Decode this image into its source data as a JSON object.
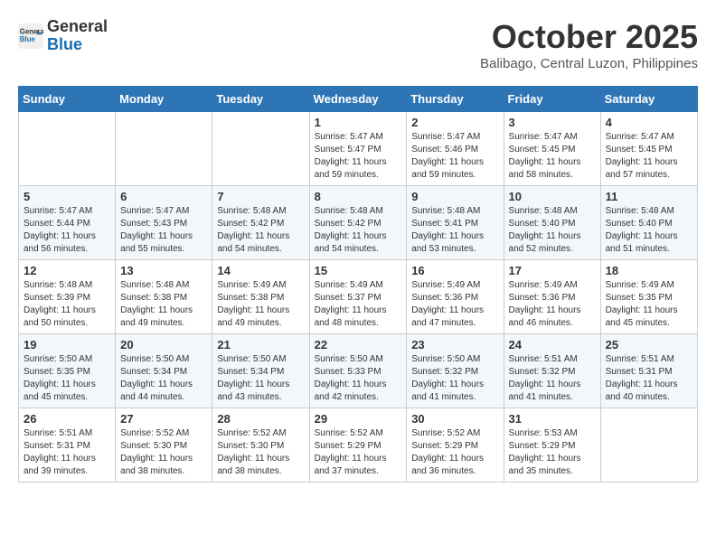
{
  "header": {
    "logo_line1": "General",
    "logo_line2": "Blue",
    "month": "October 2025",
    "location": "Balibago, Central Luzon, Philippines"
  },
  "weekdays": [
    "Sunday",
    "Monday",
    "Tuesday",
    "Wednesday",
    "Thursday",
    "Friday",
    "Saturday"
  ],
  "weeks": [
    [
      {
        "day": "",
        "info": ""
      },
      {
        "day": "",
        "info": ""
      },
      {
        "day": "",
        "info": ""
      },
      {
        "day": "1",
        "info": "Sunrise: 5:47 AM\nSunset: 5:47 PM\nDaylight: 11 hours\nand 59 minutes."
      },
      {
        "day": "2",
        "info": "Sunrise: 5:47 AM\nSunset: 5:46 PM\nDaylight: 11 hours\nand 59 minutes."
      },
      {
        "day": "3",
        "info": "Sunrise: 5:47 AM\nSunset: 5:45 PM\nDaylight: 11 hours\nand 58 minutes."
      },
      {
        "day": "4",
        "info": "Sunrise: 5:47 AM\nSunset: 5:45 PM\nDaylight: 11 hours\nand 57 minutes."
      }
    ],
    [
      {
        "day": "5",
        "info": "Sunrise: 5:47 AM\nSunset: 5:44 PM\nDaylight: 11 hours\nand 56 minutes."
      },
      {
        "day": "6",
        "info": "Sunrise: 5:47 AM\nSunset: 5:43 PM\nDaylight: 11 hours\nand 55 minutes."
      },
      {
        "day": "7",
        "info": "Sunrise: 5:48 AM\nSunset: 5:42 PM\nDaylight: 11 hours\nand 54 minutes."
      },
      {
        "day": "8",
        "info": "Sunrise: 5:48 AM\nSunset: 5:42 PM\nDaylight: 11 hours\nand 54 minutes."
      },
      {
        "day": "9",
        "info": "Sunrise: 5:48 AM\nSunset: 5:41 PM\nDaylight: 11 hours\nand 53 minutes."
      },
      {
        "day": "10",
        "info": "Sunrise: 5:48 AM\nSunset: 5:40 PM\nDaylight: 11 hours\nand 52 minutes."
      },
      {
        "day": "11",
        "info": "Sunrise: 5:48 AM\nSunset: 5:40 PM\nDaylight: 11 hours\nand 51 minutes."
      }
    ],
    [
      {
        "day": "12",
        "info": "Sunrise: 5:48 AM\nSunset: 5:39 PM\nDaylight: 11 hours\nand 50 minutes."
      },
      {
        "day": "13",
        "info": "Sunrise: 5:48 AM\nSunset: 5:38 PM\nDaylight: 11 hours\nand 49 minutes."
      },
      {
        "day": "14",
        "info": "Sunrise: 5:49 AM\nSunset: 5:38 PM\nDaylight: 11 hours\nand 49 minutes."
      },
      {
        "day": "15",
        "info": "Sunrise: 5:49 AM\nSunset: 5:37 PM\nDaylight: 11 hours\nand 48 minutes."
      },
      {
        "day": "16",
        "info": "Sunrise: 5:49 AM\nSunset: 5:36 PM\nDaylight: 11 hours\nand 47 minutes."
      },
      {
        "day": "17",
        "info": "Sunrise: 5:49 AM\nSunset: 5:36 PM\nDaylight: 11 hours\nand 46 minutes."
      },
      {
        "day": "18",
        "info": "Sunrise: 5:49 AM\nSunset: 5:35 PM\nDaylight: 11 hours\nand 45 minutes."
      }
    ],
    [
      {
        "day": "19",
        "info": "Sunrise: 5:50 AM\nSunset: 5:35 PM\nDaylight: 11 hours\nand 45 minutes."
      },
      {
        "day": "20",
        "info": "Sunrise: 5:50 AM\nSunset: 5:34 PM\nDaylight: 11 hours\nand 44 minutes."
      },
      {
        "day": "21",
        "info": "Sunrise: 5:50 AM\nSunset: 5:34 PM\nDaylight: 11 hours\nand 43 minutes."
      },
      {
        "day": "22",
        "info": "Sunrise: 5:50 AM\nSunset: 5:33 PM\nDaylight: 11 hours\nand 42 minutes."
      },
      {
        "day": "23",
        "info": "Sunrise: 5:50 AM\nSunset: 5:32 PM\nDaylight: 11 hours\nand 41 minutes."
      },
      {
        "day": "24",
        "info": "Sunrise: 5:51 AM\nSunset: 5:32 PM\nDaylight: 11 hours\nand 41 minutes."
      },
      {
        "day": "25",
        "info": "Sunrise: 5:51 AM\nSunset: 5:31 PM\nDaylight: 11 hours\nand 40 minutes."
      }
    ],
    [
      {
        "day": "26",
        "info": "Sunrise: 5:51 AM\nSunset: 5:31 PM\nDaylight: 11 hours\nand 39 minutes."
      },
      {
        "day": "27",
        "info": "Sunrise: 5:52 AM\nSunset: 5:30 PM\nDaylight: 11 hours\nand 38 minutes."
      },
      {
        "day": "28",
        "info": "Sunrise: 5:52 AM\nSunset: 5:30 PM\nDaylight: 11 hours\nand 38 minutes."
      },
      {
        "day": "29",
        "info": "Sunrise: 5:52 AM\nSunset: 5:29 PM\nDaylight: 11 hours\nand 37 minutes."
      },
      {
        "day": "30",
        "info": "Sunrise: 5:52 AM\nSunset: 5:29 PM\nDaylight: 11 hours\nand 36 minutes."
      },
      {
        "day": "31",
        "info": "Sunrise: 5:53 AM\nSunset: 5:29 PM\nDaylight: 11 hours\nand 35 minutes."
      },
      {
        "day": "",
        "info": ""
      }
    ]
  ]
}
